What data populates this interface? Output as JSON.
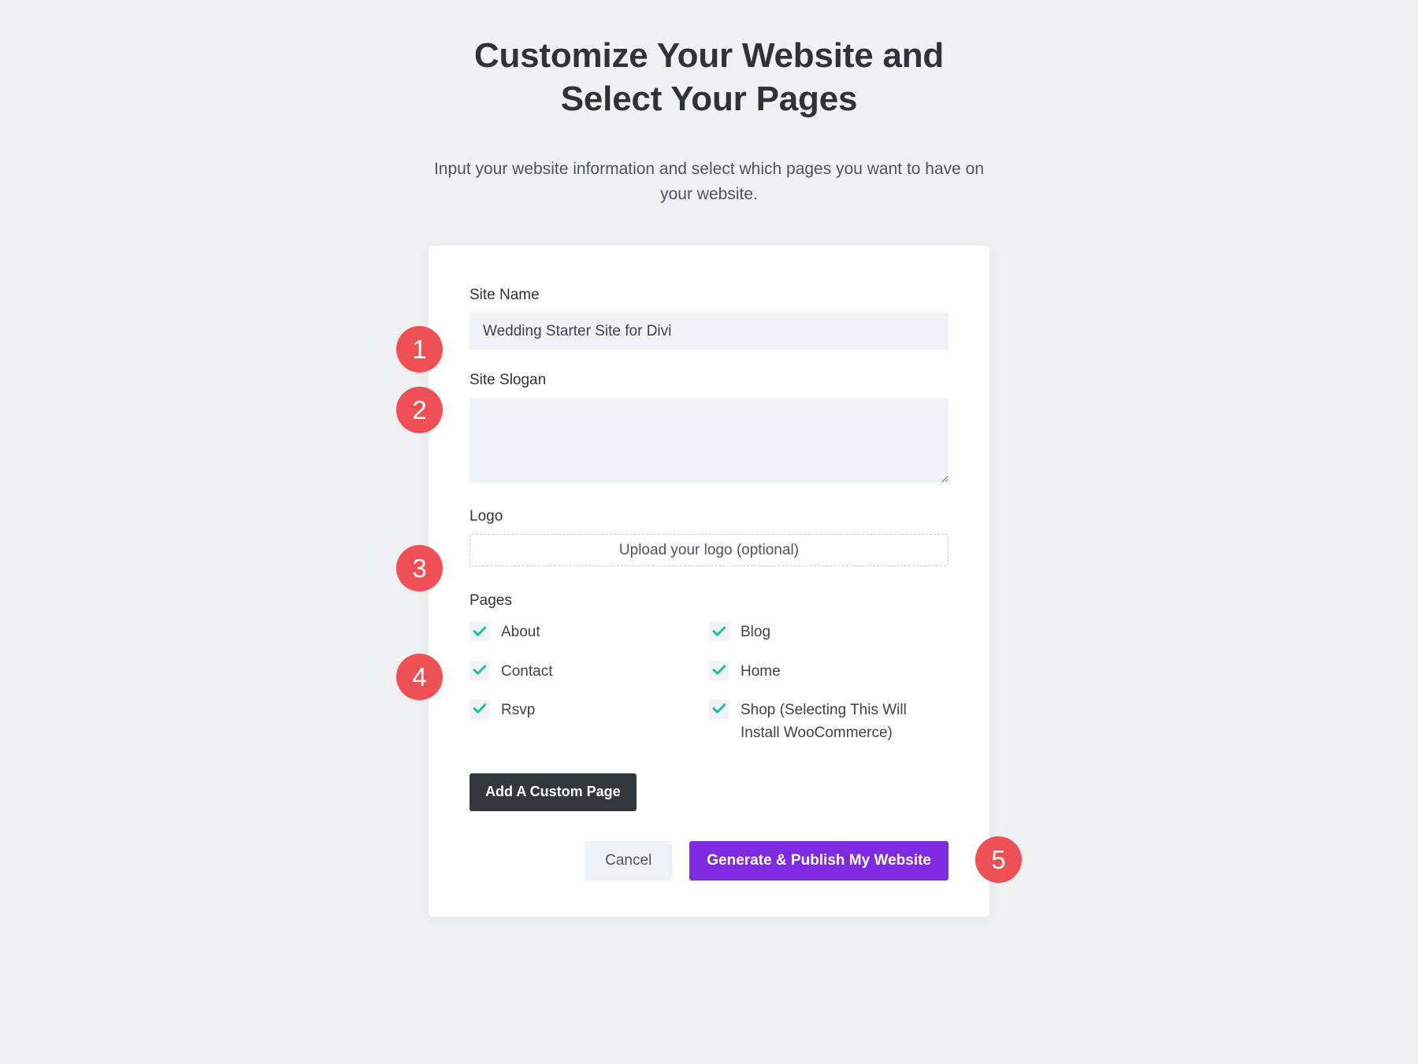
{
  "header": {
    "title": "Customize Your Website and Select Your Pages",
    "subtitle": "Input your website information and select which pages you want to have on your website."
  },
  "form": {
    "site_name": {
      "label": "Site Name",
      "value": "Wedding Starter Site for Divi",
      "placeholder": ""
    },
    "site_slogan": {
      "label": "Site Slogan",
      "value": "",
      "placeholder": ""
    },
    "logo": {
      "label": "Logo",
      "upload_text": "Upload your logo (optional)"
    },
    "pages": {
      "label": "Pages",
      "items": [
        {
          "label": "About",
          "checked": true
        },
        {
          "label": "Blog",
          "checked": true
        },
        {
          "label": "Contact",
          "checked": true
        },
        {
          "label": "Home",
          "checked": true
        },
        {
          "label": "Rsvp",
          "checked": true
        },
        {
          "label": "Shop (Selecting This Will Install WooCommerce)",
          "checked": true
        }
      ]
    },
    "add_custom_page_label": "Add A Custom Page"
  },
  "actions": {
    "cancel_label": "Cancel",
    "generate_label": "Generate & Publish My Website"
  },
  "callouts": [
    {
      "number": "1"
    },
    {
      "number": "2"
    },
    {
      "number": "3"
    },
    {
      "number": "4"
    },
    {
      "number": "5"
    }
  ],
  "colors": {
    "background": "#f0f1f3",
    "card": "#ffffff",
    "badge": "#ee5055",
    "checkmark": "#1cbf96",
    "primary_button": "#7d2ae0",
    "dark_button": "#33383d",
    "input_background": "#eff2f6",
    "heading_text": "#2e3337",
    "body_text": "#4c555c"
  }
}
